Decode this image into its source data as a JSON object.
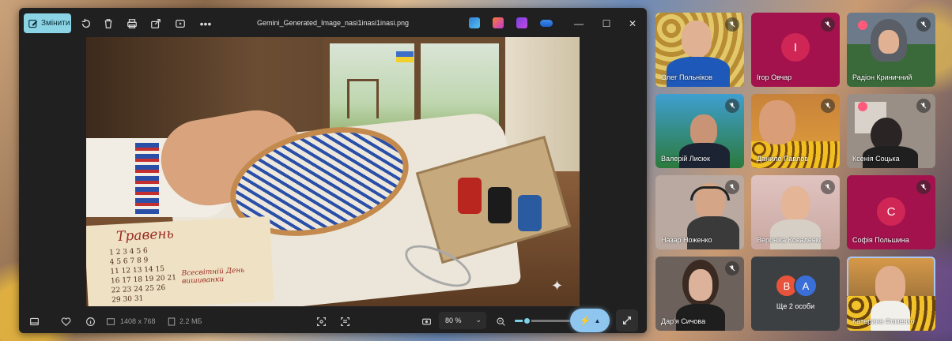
{
  "viewer": {
    "edit_label": "Змінити",
    "filename": "Gemini_Generated_Image_nasi1inasi1inasi.png",
    "dimensions": "1408 x 768",
    "filesize": "2.2 МБ",
    "zoom": "80 %",
    "zoom_level": 0.22,
    "window_controls": {
      "minimize": "—",
      "maximize": "☐",
      "close": "✕"
    }
  },
  "image": {
    "calendar_title": "Травень",
    "calendar_rows": [
      "1  2  3  4  5  6",
      "4  5  6  7  8  9",
      "11 12 13 14 15",
      "16 17 18 19 20 21",
      "22 23 24 25 26",
      "29 30 31"
    ],
    "calendar_note": [
      "Всесвітній День",
      "вишиванки"
    ]
  },
  "participants": [
    {
      "name": "Олег Польніков",
      "muted": true
    },
    {
      "name": "Ігор Овчар",
      "initial": "I",
      "muted": true
    },
    {
      "name": "Радіон Криничний",
      "muted": true
    },
    {
      "name": "Валерій Лисюк",
      "muted": true
    },
    {
      "name": "Данило Павлов",
      "muted": true
    },
    {
      "name": "Ксенія Соцька",
      "muted": true
    },
    {
      "name": "Назар Ноженко",
      "muted": true
    },
    {
      "name": "Вероніка Коваленко",
      "muted": true
    },
    {
      "name": "Софія Польшина",
      "initial": "С",
      "muted": true
    },
    {
      "name": "Дар'я Сичова",
      "muted": true
    },
    {
      "name": "Ще 2 особи",
      "initials": [
        "В",
        "А"
      ]
    },
    {
      "name": "Катерина Фоменко"
    }
  ],
  "colors": {
    "accent": "#8ad4e6",
    "tile_magenta": "#a3124d",
    "tile_dark": "#3c4043"
  }
}
